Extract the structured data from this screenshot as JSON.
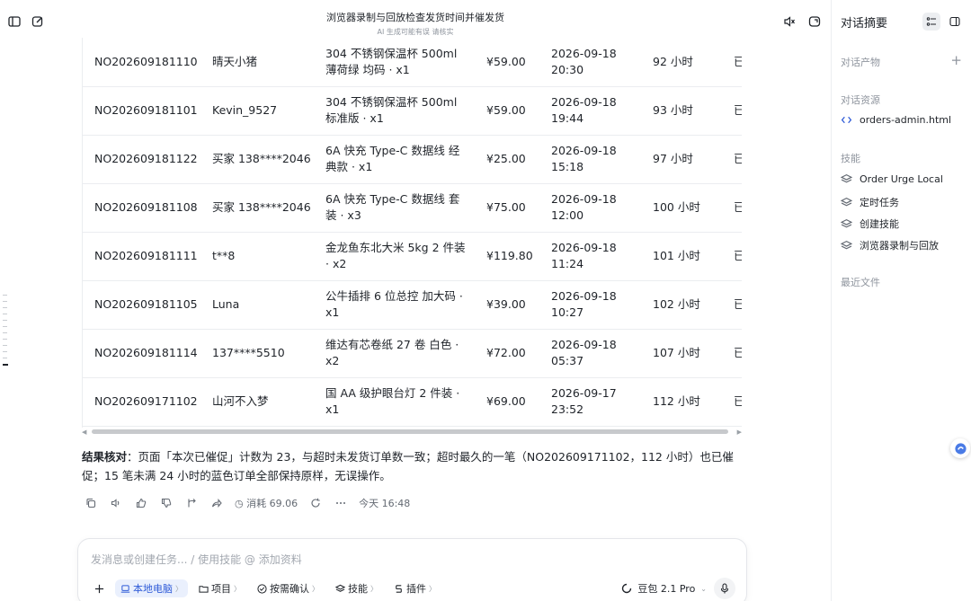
{
  "header": {
    "title": "浏览器录制与回放检查发货时间并催发货",
    "subtitle": "AI 生成可能有误 请核实"
  },
  "orders": [
    {
      "id": "NO202609181110",
      "buyer": "晴天小猪",
      "goods": "304 不锈钢保温杯 500ml 薄荷绿 均码 · x1",
      "amount": "¥59.00",
      "time": "2026-09-18 20:30",
      "overdue": "92 小时",
      "status": "已"
    },
    {
      "id": "NO202609181101",
      "buyer": "Kevin_9527",
      "goods": "304 不锈钢保温杯 500ml 标准版 · x1",
      "amount": "¥59.00",
      "time": "2026-09-18 19:44",
      "overdue": "93 小时",
      "status": "已"
    },
    {
      "id": "NO202609181122",
      "buyer": "买家 138****2046",
      "goods": "6A 快充 Type-C 数据线 经典款 · x1",
      "amount": "¥25.00",
      "time": "2026-09-18 15:18",
      "overdue": "97 小时",
      "status": "已"
    },
    {
      "id": "NO202609181108",
      "buyer": "买家 138****2046",
      "goods": "6A 快充 Type-C 数据线 套装 · x3",
      "amount": "¥75.00",
      "time": "2026-09-18 12:00",
      "overdue": "100 小时",
      "status": "已"
    },
    {
      "id": "NO202609181111",
      "buyer": "t**8",
      "goods": "金龙鱼东北大米 5kg 2 件装 · x2",
      "amount": "¥119.80",
      "time": "2026-09-18 11:24",
      "overdue": "101 小时",
      "status": "已"
    },
    {
      "id": "NO202609181105",
      "buyer": "Luna",
      "goods": "公牛插排 6 位总控 加大码 · x1",
      "amount": "¥39.00",
      "time": "2026-09-18 10:27",
      "overdue": "102 小时",
      "status": "已"
    },
    {
      "id": "NO202609181114",
      "buyer": "137****5510",
      "goods": "维达有芯卷纸 27 卷 白色 · x2",
      "amount": "¥72.00",
      "time": "2026-09-18 05:37",
      "overdue": "107 小时",
      "status": "已"
    },
    {
      "id": "NO202609171102",
      "buyer": "山河不入梦",
      "goods": "国 AA 级护眼台灯 2 件装 · x1",
      "amount": "¥69.00",
      "time": "2026-09-17 23:52",
      "overdue": "112 小时",
      "status": "已"
    }
  ],
  "result": {
    "label": "结果核对",
    "text": "：页面「本次已催促」计数为 23，与超时未发货订单数一致；超时最久的一笔（NO202609171102，112 小时）也已催促；15 笔未满 24 小时的蓝色订单全部保持原样，无误操作。"
  },
  "message_actions": {
    "usage": "消耗 69.06",
    "timestamp": "今天 16:48"
  },
  "composer": {
    "placeholder": "发消息或创建任务... / 使用技能 @ 添加资料",
    "chips": {
      "computer": "本地电脑",
      "project": "项目",
      "confirm": "按需确认",
      "skills": "技能",
      "plugins": "插件"
    },
    "model": "豆包 2.1 Pro"
  },
  "panel": {
    "title": "对话摘要",
    "outputs_label": "对话产物",
    "resources_label": "对话资源",
    "resource_file": "orders-admin.html",
    "skills_label": "技能",
    "skills": [
      "Order Urge Local",
      "定时任务",
      "创建技能",
      "浏览器录制与回放"
    ],
    "files_label": "最近文件"
  },
  "colors": {
    "accent": "#2f5bd8",
    "border": "#ebedf0",
    "muted": "#8f959e"
  }
}
